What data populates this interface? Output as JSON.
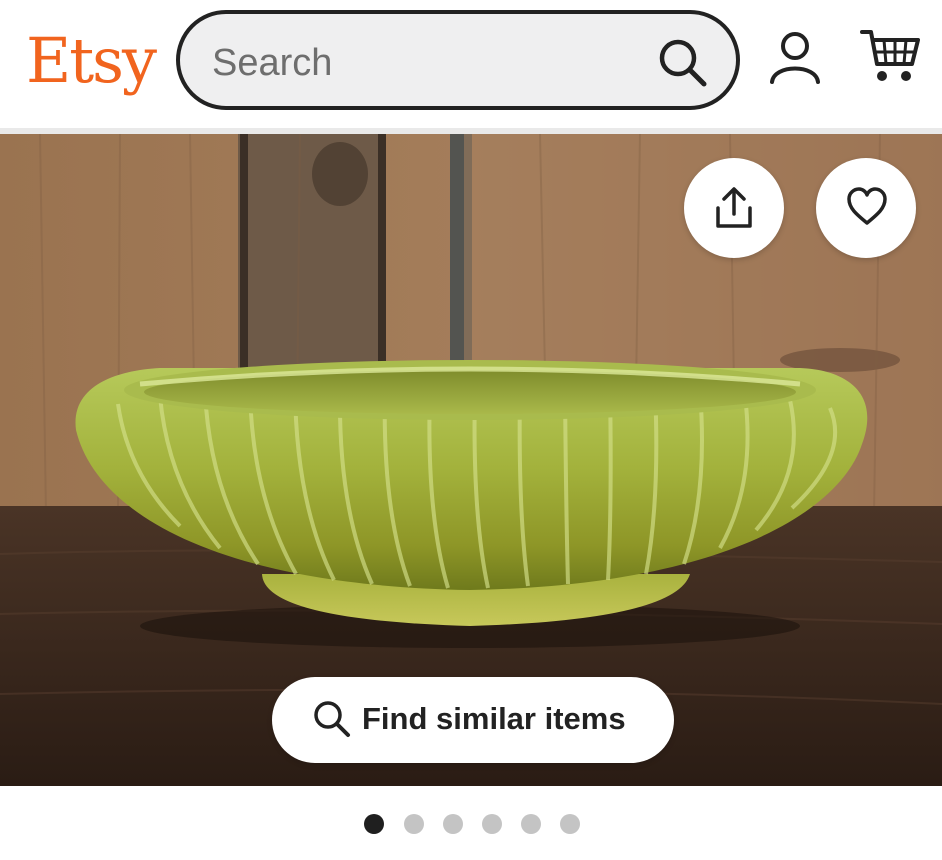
{
  "header": {
    "logo_text": "Etsy",
    "search": {
      "placeholder": "Search",
      "value": ""
    },
    "icons": [
      "search-icon",
      "account-icon",
      "cart-icon"
    ]
  },
  "listing_gallery": {
    "image_alt": "Green ribbed ceramic oval bowl on a wooden table",
    "share_icon": "share-icon",
    "favorite_icon": "heart-icon",
    "find_similar": {
      "label": "Find similar items",
      "icon": "search-icon"
    },
    "pagination": {
      "total": 6,
      "active_index": 0
    }
  },
  "colors": {
    "brand": "#f1641e",
    "text": "#222222",
    "dot_active": "#1f1f1f",
    "dot_inactive": "#c4c4c4"
  }
}
